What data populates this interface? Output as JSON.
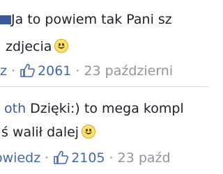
{
  "comments": [
    {
      "author": "",
      "text_line1": "Ja to powiem tak Pani sz",
      "text_line2": "zdjecia",
      "reply_label": "z",
      "likes": "2061",
      "date": "23 październi"
    },
    {
      "author": "oth",
      "text_line1": " Dzięki:) to mega kompl",
      "text_line2": "ś walił dalej",
      "reply_label": "owiedz",
      "likes": "2105",
      "date": "23 paźd"
    }
  ],
  "colors": {
    "link": "#4267b2",
    "author": "#3b5998",
    "text": "#1d2129",
    "meta": "#90949c"
  },
  "icons": {
    "like": "thumbs-up-icon",
    "emoji": "smiley-emoji-icon"
  }
}
